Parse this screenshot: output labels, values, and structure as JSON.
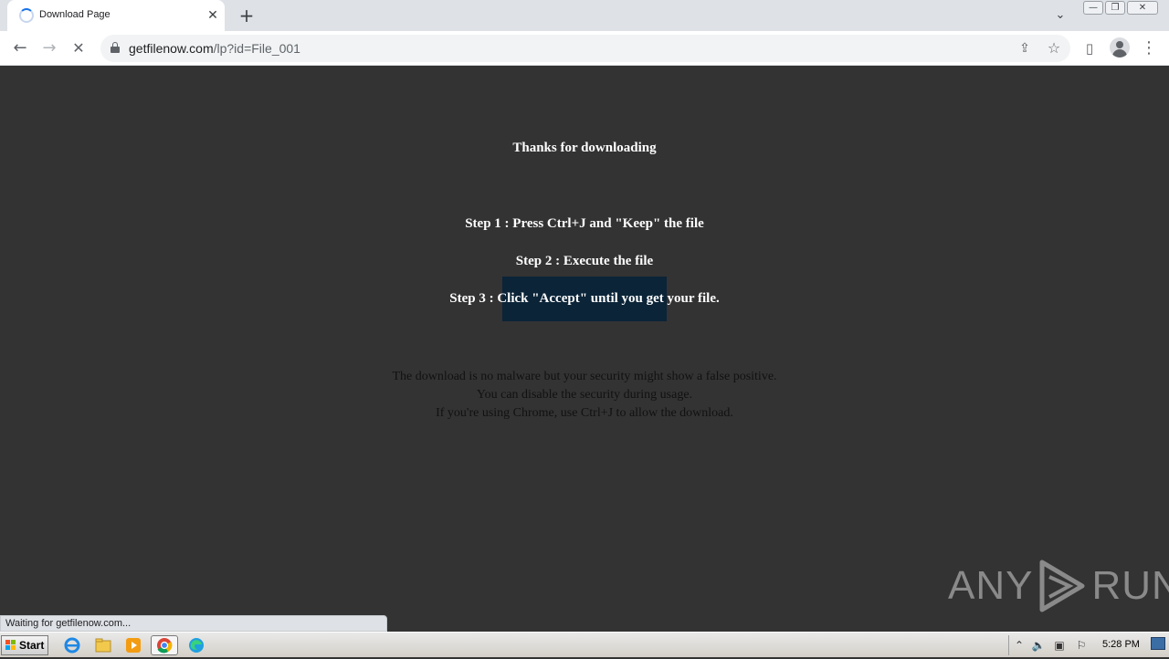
{
  "tab": {
    "title": "Download Page",
    "close": "✕",
    "new_tab": "+"
  },
  "window_controls": {
    "minimize": "—",
    "restore": "❐",
    "close": "✕"
  },
  "toolbar": {
    "back": "←",
    "forward": "→",
    "stop": "✕",
    "url_host": "getfilenow.com",
    "url_path": "/lp?id=File_001",
    "share": "⇪",
    "bookmark": "☆",
    "side_panel": "▯",
    "menu": "⋮"
  },
  "page": {
    "heading": "Thanks for downloading",
    "steps": [
      "Step 1 : Press Ctrl+J and \"Keep\" the file",
      "Step 2 : Execute the file",
      "Step 3 : Click \"Accept\" until you get your file."
    ],
    "notes": [
      "The download is no malware but your security might show a false positive.",
      "You can disable the security during usage.",
      "If you're using Chrome, use Ctrl+J to allow the download."
    ]
  },
  "watermark": {
    "left": "ANY",
    "right": "RUN"
  },
  "status_bar": "Waiting for getfilenow.com...",
  "taskbar": {
    "start": "Start",
    "clock": "5:28 PM",
    "tray_arrow": "⌃",
    "volume": "🔈",
    "network": "▣",
    "flag": "⚐"
  },
  "colors": {
    "page_bg": "#333333",
    "highlight": "#0b2438",
    "tab_strip": "#dee1e6",
    "accent": "#1a73e8"
  }
}
